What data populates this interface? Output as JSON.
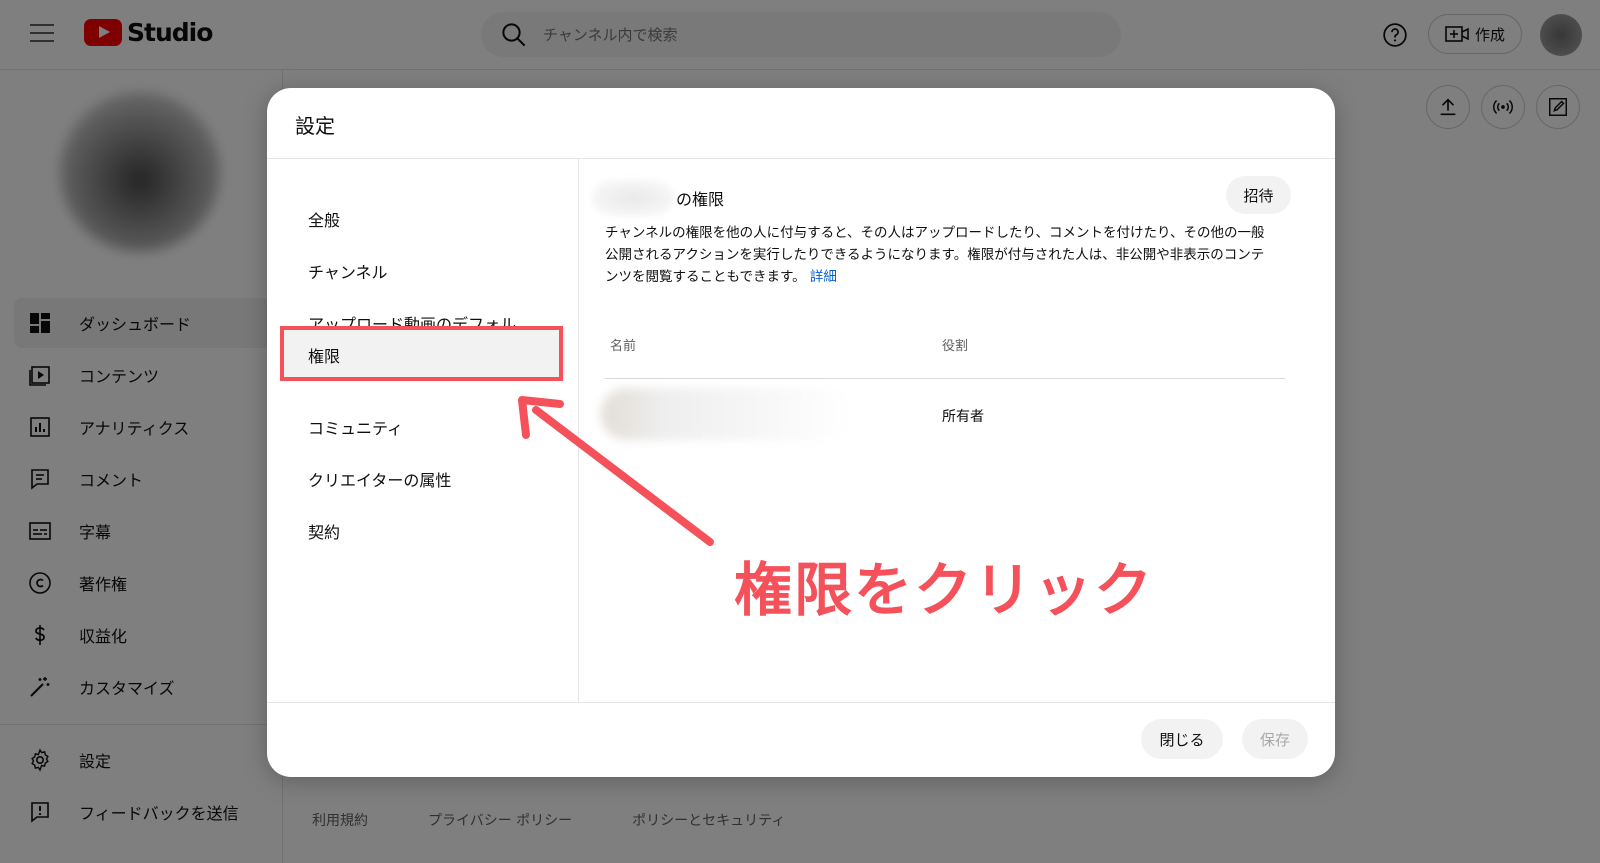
{
  "header": {
    "logo_text": "Studio",
    "search_placeholder": "チャンネル内で検索",
    "create_label": "作成"
  },
  "sidebar": {
    "items": [
      {
        "label": "ダッシュボード",
        "icon": "dashboard-icon"
      },
      {
        "label": "コンテンツ",
        "icon": "content-icon"
      },
      {
        "label": "アナリティクス",
        "icon": "analytics-icon"
      },
      {
        "label": "コメント",
        "icon": "comment-icon"
      },
      {
        "label": "字幕",
        "icon": "subtitles-icon"
      },
      {
        "label": "著作権",
        "icon": "copyright-icon"
      },
      {
        "label": "収益化",
        "icon": "dollar-icon"
      },
      {
        "label": "カスタマイズ",
        "icon": "magic-wand-icon"
      }
    ],
    "bottom_items": [
      {
        "label": "設定",
        "icon": "gear-icon"
      },
      {
        "label": "フィードバックを送信",
        "icon": "feedback-icon"
      }
    ]
  },
  "footer": {
    "links": [
      "利用規約",
      "プライバシー ポリシー",
      "ポリシーとセキュリティ"
    ]
  },
  "dialog": {
    "title": "設定",
    "menu": [
      {
        "label": "全般"
      },
      {
        "label": "チャンネル"
      },
      {
        "label": "アップロード動画のデフォル..."
      },
      {
        "label": "権限",
        "selected": true
      },
      {
        "label": "コミュニティ"
      },
      {
        "label": "クリエイターの属性"
      },
      {
        "label": "契約"
      }
    ],
    "permissions": {
      "title_suffix": "の権限",
      "invite_label": "招待",
      "description": "チャンネルの権限を他の人に付与すると、その人はアップロードしたり、コメントを付けたり、その他の一般公開されるアクションを実行したりできるようになります。権限が付与された人は、非公開や非表示のコンテンツを閲覧することもできます。",
      "learn_more": "詳細",
      "columns": {
        "name": "名前",
        "role": "役割"
      },
      "rows": [
        {
          "role": "所有者"
        }
      ]
    },
    "close_label": "閉じる",
    "save_label": "保存"
  },
  "annotation": {
    "text": "権限をクリック",
    "color": "#f4515a"
  }
}
